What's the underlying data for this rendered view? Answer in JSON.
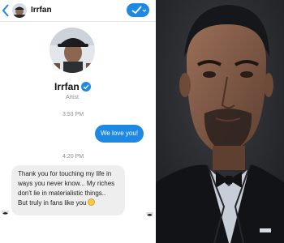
{
  "chat": {
    "header_name": "Irrfan",
    "profile_name": "Irrfan",
    "profile_role": "Artist",
    "timestamp_1": "3:53 PM",
    "outgoing_message": "We love you!",
    "timestamp_2": "4:20 PM",
    "incoming_lines": [
      "Thank you for touching my life in",
      "ways you never know... My riches",
      "don't lie in materialistic things..",
      "But truly in fans like you"
    ],
    "emoji": "slightly-smiling-face-emoji"
  },
  "colors": {
    "accent_blue": "#1e88e5",
    "incoming_bubble": "#eeeeef",
    "portrait_background": "#2a2c30"
  },
  "icons": [
    "back-chevron-icon",
    "verified-badge-icon",
    "checkmark-dropdown-icon"
  ]
}
